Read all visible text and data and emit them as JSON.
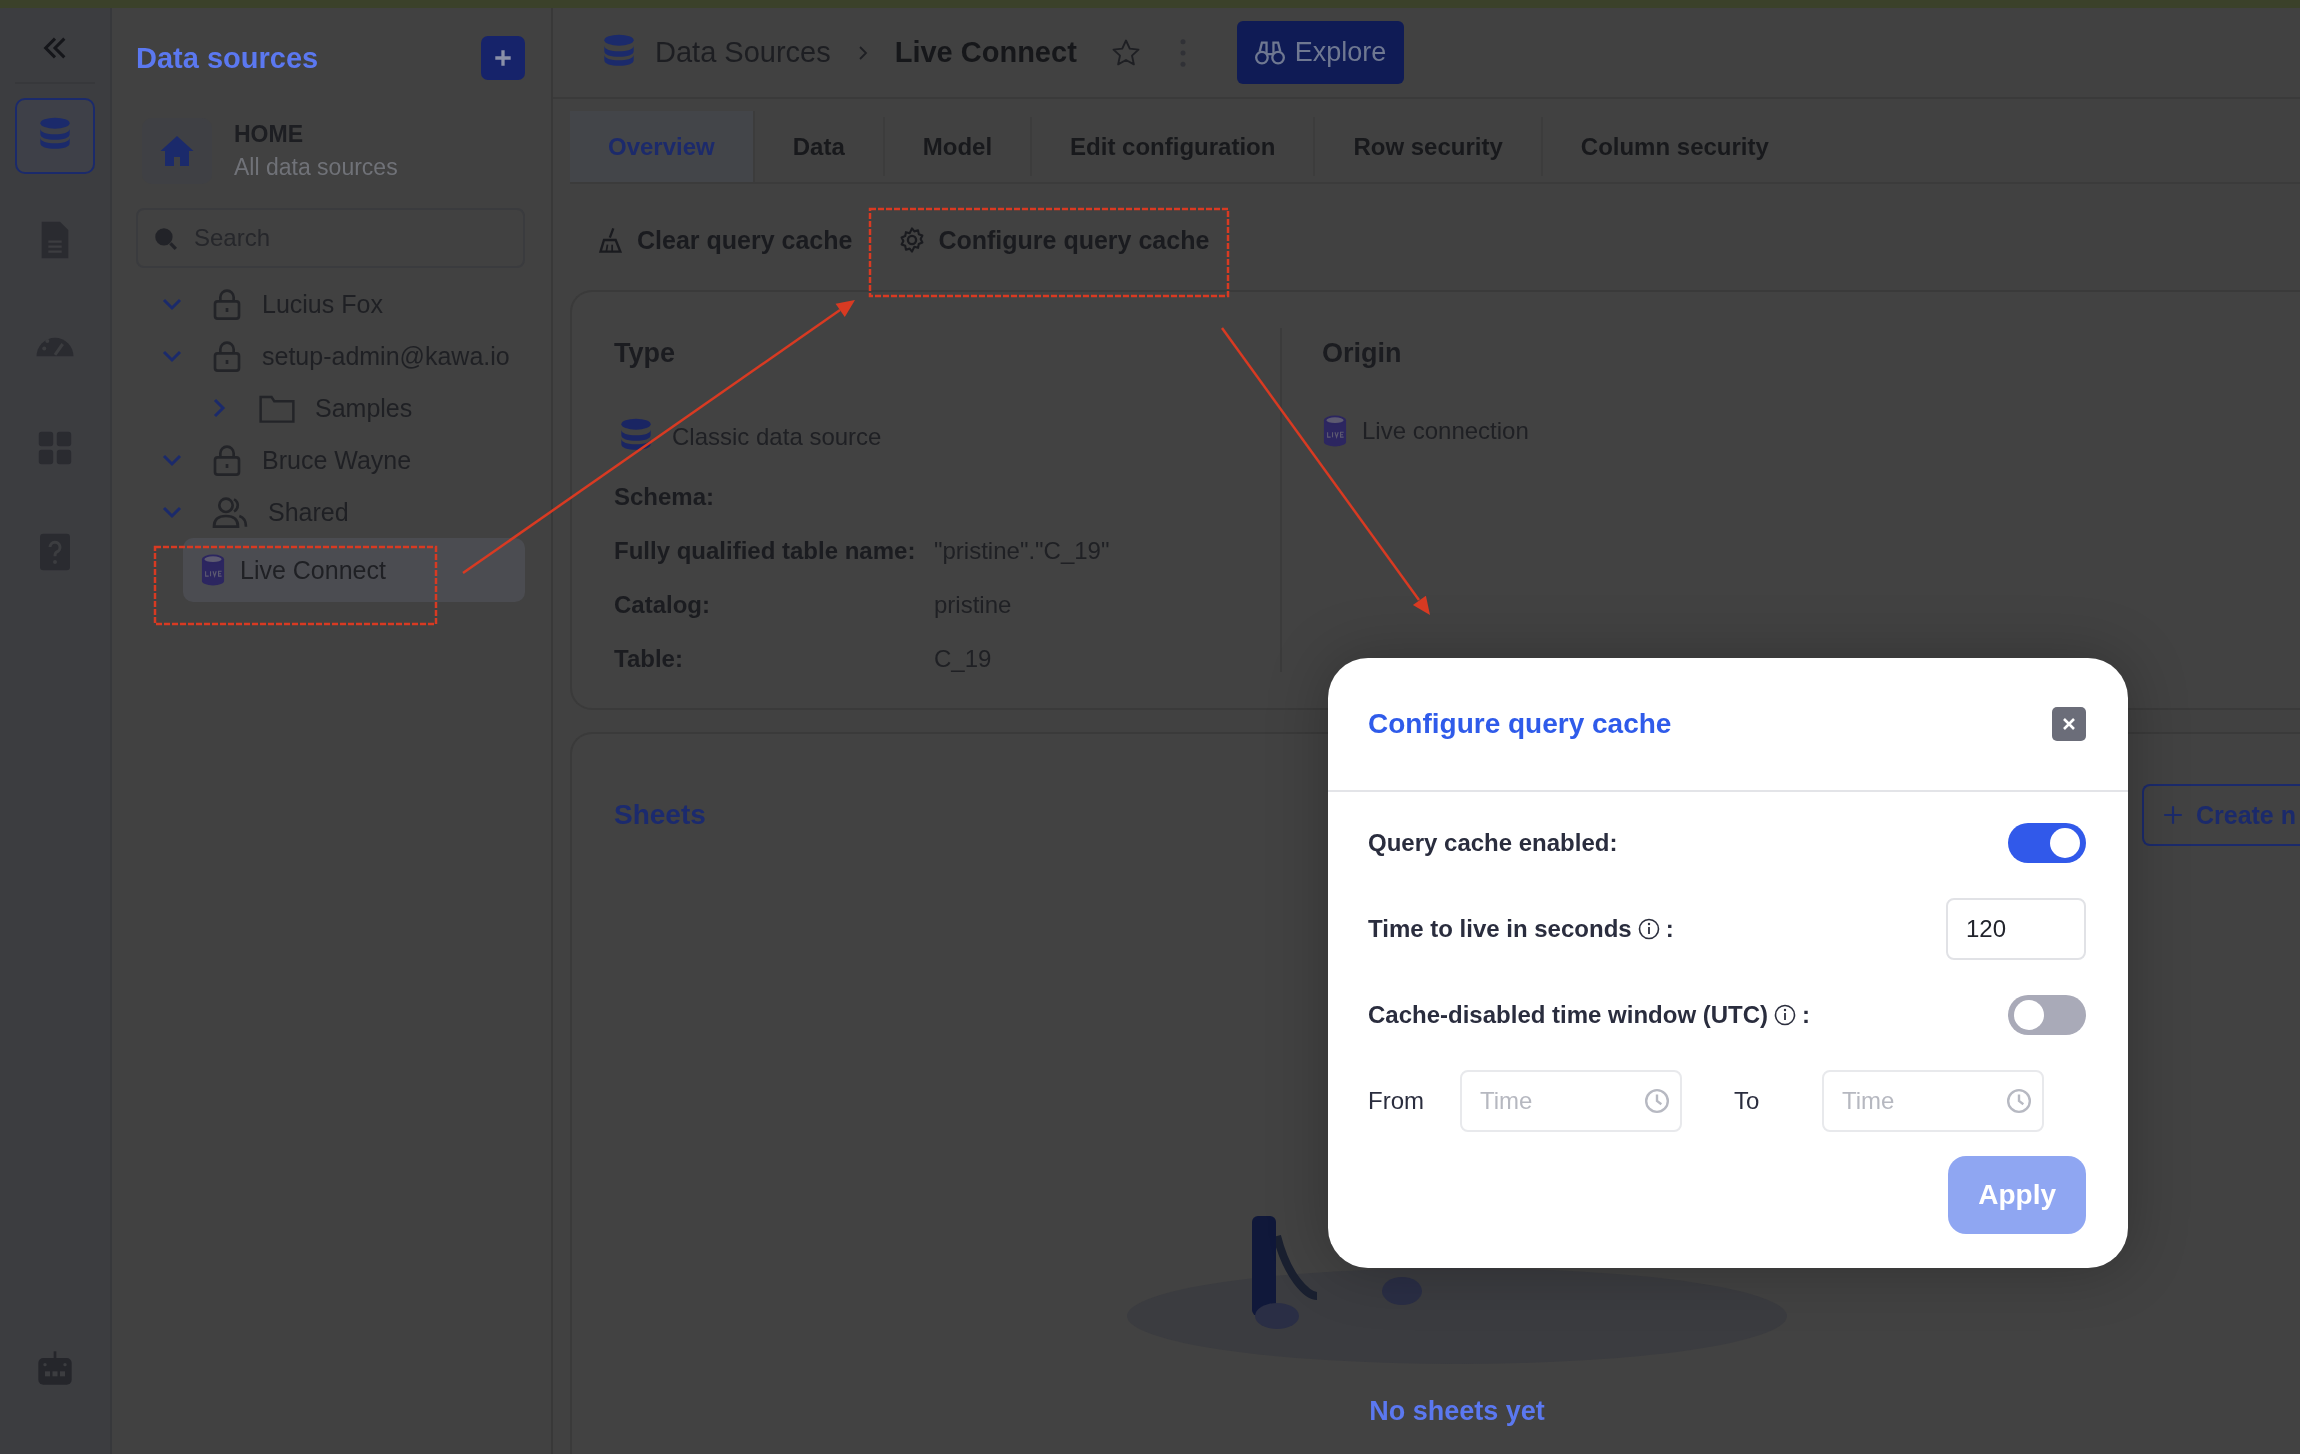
{
  "rail": {
    "items": [
      {
        "kind": "database",
        "selected": true
      },
      {
        "kind": "document",
        "selected": false
      },
      {
        "kind": "gauge",
        "selected": false
      },
      {
        "kind": "grid",
        "selected": false
      },
      {
        "kind": "help",
        "selected": false
      }
    ],
    "bottom_items": [
      {
        "kind": "robot"
      }
    ]
  },
  "sidebar": {
    "title": "Data sources",
    "home": {
      "title": "HOME",
      "subtitle": "All data sources"
    },
    "search": {
      "placeholder": "Search"
    },
    "tree": [
      {
        "label": "Lucius Fox",
        "kind": "lock",
        "expanded": true,
        "selected": false
      },
      {
        "label": "setup-admin@kawa.io",
        "kind": "lock",
        "expanded": true,
        "selected": false,
        "children": [
          {
            "label": "Samples",
            "kind": "folder",
            "expanded": false,
            "selected": false
          }
        ]
      },
      {
        "label": "Bruce Wayne",
        "kind": "lock",
        "expanded": true,
        "selected": false
      },
      {
        "label": "Shared",
        "kind": "users",
        "expanded": true,
        "selected": false,
        "children": [
          {
            "label": "Live Connect",
            "kind": "live",
            "selected": true
          }
        ]
      }
    ]
  },
  "header": {
    "breadcrumb": [
      "Data Sources",
      "Live Connect"
    ],
    "explore_button": "Explore"
  },
  "tabs": [
    {
      "label": "Overview",
      "selected": true
    },
    {
      "label": "Data",
      "selected": false
    },
    {
      "label": "Model",
      "selected": false
    },
    {
      "label": "Edit configuration",
      "selected": false
    },
    {
      "label": "Row security",
      "selected": false
    },
    {
      "label": "Column security",
      "selected": false
    }
  ],
  "actions": [
    {
      "label": "Clear query cache",
      "kind": "broom"
    },
    {
      "label": "Configure query cache",
      "kind": "gear"
    }
  ],
  "details": {
    "type": {
      "heading": "Type",
      "value": "Classic data source",
      "fields": [
        {
          "label": "Schema:"
        },
        {
          "label": "Fully qualified table name:",
          "value": "\"pristine\".\"C_19\""
        },
        {
          "label": "Catalog:",
          "value": "pristine"
        },
        {
          "label": "Table:",
          "value": "C_19"
        }
      ]
    },
    "origin": {
      "heading": "Origin",
      "value": "Live connection"
    }
  },
  "sheets": {
    "heading": "Sheets",
    "create_button": "Create n",
    "empty_text": "No sheets yet"
  },
  "modal": {
    "title": "Configure query cache",
    "rows": [
      {
        "kind": "toggle",
        "label": "Query cache enabled:",
        "on": true
      },
      {
        "kind": "number",
        "label": "Time to live in seconds",
        "info": true,
        "suffix": ":",
        "value": "120"
      },
      {
        "kind": "toggle",
        "label": "Cache-disabled time window (UTC)",
        "info": true,
        "suffix": ":",
        "on": false
      },
      {
        "kind": "time_range",
        "from_label": "From",
        "from_placeholder": "Time",
        "to_label": "To",
        "to_placeholder": "Time"
      }
    ],
    "apply_button": {
      "label": "Apply",
      "disabled": true
    }
  }
}
